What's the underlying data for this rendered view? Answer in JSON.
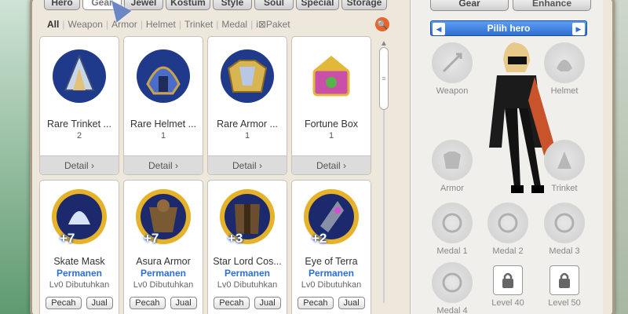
{
  "tabs": [
    {
      "label": "Hero",
      "width": 46
    },
    {
      "label": "Gear",
      "width": 50
    },
    {
      "label": "Jewel",
      "width": 50
    },
    {
      "label": "Kostum",
      "width": 57
    },
    {
      "label": "Style",
      "width": 50
    },
    {
      "label": "Soul",
      "width": 50
    },
    {
      "label": "Special",
      "width": 55
    },
    {
      "label": "Storage",
      "width": 58
    }
  ],
  "filters": [
    "All",
    "Weapon",
    "Armor",
    "Helmet",
    "Trinket",
    "Medal",
    "i⊠Paket"
  ],
  "items_row1": [
    {
      "name": "Rare Trinket ...",
      "qty": "2",
      "detail": "Detail ›",
      "icon": "trinket-icon"
    },
    {
      "name": "Rare Helmet ...",
      "qty": "1",
      "detail": "Detail ›",
      "icon": "helmet-icon"
    },
    {
      "name": "Rare Armor ...",
      "qty": "1",
      "detail": "Detail ›",
      "icon": "armor-icon"
    },
    {
      "name": "Fortune Box",
      "qty": "1",
      "detail": "Detail ›",
      "icon": "fortune-box-icon"
    }
  ],
  "items_row2": [
    {
      "name": "Skate Mask",
      "level": "+7",
      "perm": "Permanen",
      "req": "Lv0 Dibutuhkan",
      "btn1": "Pecah",
      "btn2": "Jual",
      "icon": "mask-icon"
    },
    {
      "name": "Asura Armor",
      "level": "+7",
      "perm": "Permanen",
      "req": "Lv0 Dibutuhkan",
      "btn1": "Pecah",
      "btn2": "Jual",
      "icon": "asura-armor-icon"
    },
    {
      "name": "Star Lord Cos...",
      "level": "+3",
      "perm": "Permanen",
      "req": "Lv0 Dibutuhkan",
      "btn1": "Pecah",
      "btn2": "Jual",
      "icon": "star-lord-icon"
    },
    {
      "name": "Eye of Terra",
      "level": "+2",
      "perm": "Permanen",
      "req": "Lv0 Dibutuhkan",
      "btn1": "Pecah",
      "btn2": "Jual",
      "icon": "eye-of-terra-icon"
    }
  ],
  "right": {
    "tab_gear": "Gear",
    "tab_enhance": "Enhance",
    "hero_select": "Pilih hero",
    "slots": {
      "weapon": "Weapon",
      "helmet": "Helmet",
      "armor": "Armor",
      "trinket": "Trinket",
      "medal1": "Medal 1",
      "medal2": "Medal 2",
      "medal3": "Medal 3",
      "medal4": "Medal 4",
      "lock40": "Level 40",
      "lock50": "Level 50"
    }
  },
  "colors": {
    "accent_blue": "#2e6fd1",
    "permanen_text": "#2d6ecf",
    "search_orange": "#e8642c"
  }
}
